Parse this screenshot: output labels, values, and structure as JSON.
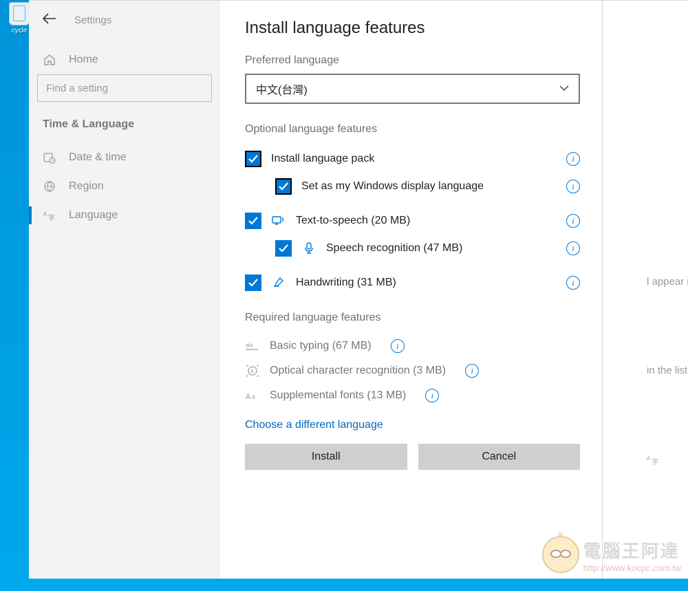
{
  "desktop": {
    "recycle_label": "cycle"
  },
  "sidebar": {
    "title": "Settings",
    "home": "Home",
    "search_placeholder": "Find a setting",
    "category": "Time & Language",
    "items": [
      {
        "label": "Date & time"
      },
      {
        "label": "Region"
      },
      {
        "label": "Language"
      }
    ]
  },
  "dialog": {
    "title": "Install language features",
    "preferred_label": "Preferred language",
    "selected_language": "中文(台灣)",
    "optional_heading": "Optional language features",
    "options": {
      "install_pack": "Install language pack",
      "set_display": "Set as my Windows display language",
      "tts": "Text-to-speech (20 MB)",
      "speech": "Speech recognition (47 MB)",
      "handwriting": "Handwriting (31 MB)"
    },
    "required_heading": "Required language features",
    "required": {
      "basic": "Basic typing (67 MB)",
      "ocr": "Optical character recognition (3 MB)",
      "fonts": "Supplemental fonts (13 MB)"
    },
    "choose_link": "Choose a different language",
    "install_btn": "Install",
    "cancel_btn": "Cancel"
  },
  "behind": {
    "line1": "l appear in this",
    "line2": "in the list that"
  },
  "watermark": {
    "cn": "電腦王阿達",
    "url": "http://www.kocpc.com.tw"
  }
}
